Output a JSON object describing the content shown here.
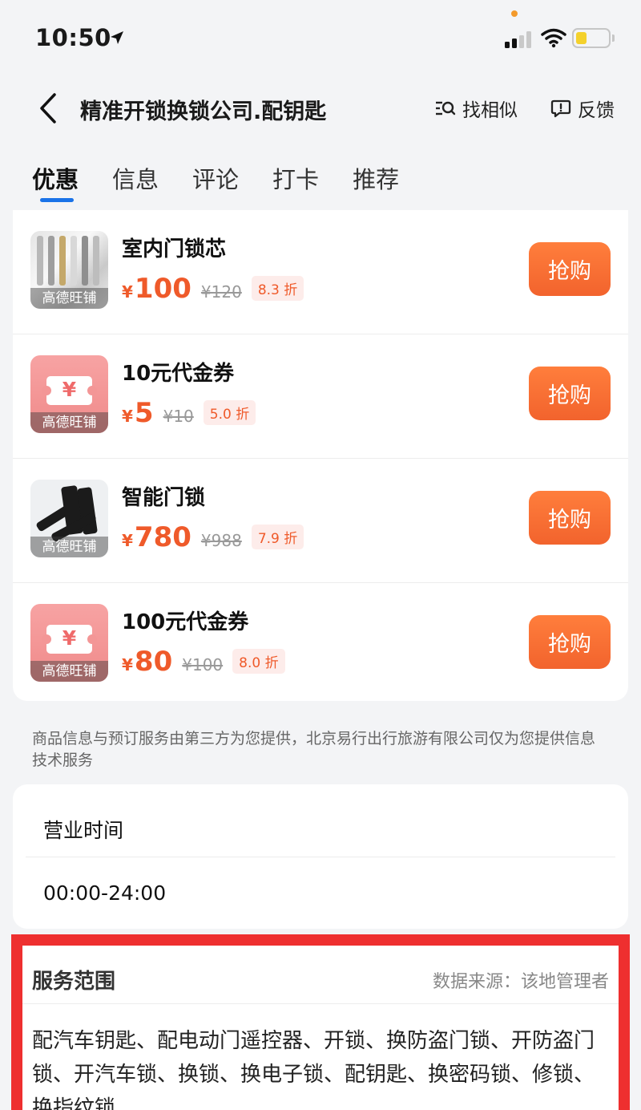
{
  "status_bar": {
    "time": "10:50",
    "battery_color": "#f4d12c",
    "icons": [
      "location-arrow-icon",
      "signal-icon",
      "wifi-icon",
      "battery-icon"
    ]
  },
  "header": {
    "title": "精准开锁换锁公司.配钥匙",
    "find_similar_label": "找相似",
    "feedback_label": "反馈",
    "icons": [
      "back-chevron-icon",
      "find-similar-icon",
      "feedback-icon"
    ]
  },
  "tabs": [
    {
      "label": "优惠",
      "active": true
    },
    {
      "label": "信息",
      "active": false
    },
    {
      "label": "评论",
      "active": false
    },
    {
      "label": "打卡",
      "active": false
    },
    {
      "label": "推荐",
      "active": false
    }
  ],
  "deals": [
    {
      "name": "室内门锁芯",
      "currency": "¥",
      "price": "100",
      "original_price": "¥120",
      "discount": "8.3 折",
      "thumb_label": "高德旺铺",
      "thumb_type": "keys",
      "button_label": "抢购"
    },
    {
      "name": "10元代金券",
      "currency": "¥",
      "price": "5",
      "original_price": "¥10",
      "discount": "5.0 折",
      "thumb_label": "高德旺铺",
      "thumb_type": "coupon",
      "thumb_symbol": "¥",
      "button_label": "抢购"
    },
    {
      "name": "智能门锁",
      "currency": "¥",
      "price": "780",
      "original_price": "¥988",
      "discount": "7.9 折",
      "thumb_label": "高德旺铺",
      "thumb_type": "lock",
      "button_label": "抢购"
    },
    {
      "name": "100元代金券",
      "currency": "¥",
      "price": "80",
      "original_price": "¥100",
      "discount": "8.0 折",
      "thumb_label": "高德旺铺",
      "thumb_type": "coupon",
      "thumb_symbol": "¥",
      "button_label": "抢购"
    }
  ],
  "disclaimer": "商品信息与预订服务由第三方为您提供，北京易行出行旅游有限公司仅为您提供信息技术服务",
  "business_hours": {
    "title": "营业时间",
    "value": "00:00-24:00"
  },
  "service_scope": {
    "title": "服务范围",
    "source": "数据来源：该地管理者",
    "text": "配汽车钥匙、配电动门遥控器、开锁、换防盗门锁、开防盗门锁、开汽车锁、换锁、换电子锁、配钥匙、换密码锁、修锁、换指纹锁",
    "highlight_color": "#ee2f2f"
  },
  "colors": {
    "accent_blue": "#1a73e8",
    "price_orange": "#ef5a2a",
    "button_orange": "#f2632d"
  }
}
